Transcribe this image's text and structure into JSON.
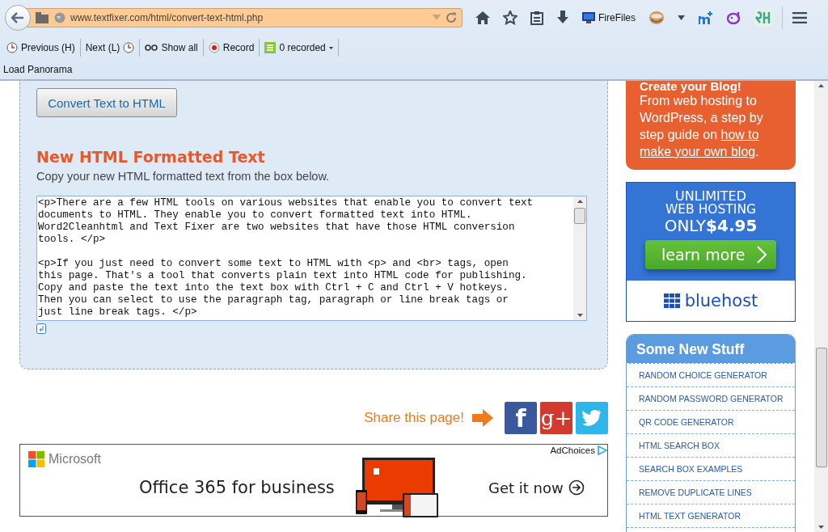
{
  "browser": {
    "url": "www.textfixer.com/html/convert-text-html.php",
    "toolbar_buttons": [
      {
        "kind": "home"
      },
      {
        "kind": "star"
      },
      {
        "kind": "reading-list"
      },
      {
        "kind": "download"
      },
      {
        "kind": "firefiles",
        "label": "FireFiles"
      },
      {
        "kind": "cup"
      },
      {
        "kind": "caret"
      },
      {
        "kind": "extension"
      },
      {
        "kind": "yahoo"
      },
      {
        "kind": "logo"
      }
    ],
    "bookmarks": [
      {
        "kind": "previous",
        "label": "Previous (H)"
      },
      {
        "kind": "next",
        "label": "Next (L)"
      },
      {
        "kind": "showall",
        "label": "Show all"
      },
      {
        "kind": "record",
        "label": "Record"
      },
      {
        "kind": "recorded",
        "label": "0 recorded"
      }
    ],
    "panorama": "Load Panorama"
  },
  "main": {
    "convert_button": "Convert Text to HTML",
    "heading": "New HTML Formatted Text",
    "subtext": "Copy your new HTML formatted text from the box below.",
    "output": "<p>There are a few HTML tools on various websites that enable you to convert text\ndocuments to HTML. They enable you to convert formatted text into HTML.\nWord2Cleanhtml and Text Fixer are two websites that have those HTML conversion\ntools. </p>\n\n<p>If you just need to convert some text to HTML with <p> and <br> tags, open\nthis page. That's a tool that converts plain text into HTML code for publishing.\nCopy and paste the text into the text box with Ctrl + C and Ctrl + V hotkeys.\nThen you can select to use the paragraph tag, paragraph or line break tags or\njust line break tags. </p>",
    "share": {
      "label": "Share this page!",
      "buttons": [
        {
          "kind": "facebook",
          "glyph": "f"
        },
        {
          "kind": "googleplus",
          "glyph": "g+"
        },
        {
          "kind": "twitter"
        }
      ]
    },
    "ad": {
      "brand": "Microsoft",
      "headline": "Office 365 for business",
      "cta": "Get it now",
      "adchoices": "AdChoices"
    }
  },
  "sidebar": {
    "blog_card": {
      "title": "Create your Blog!",
      "text": "From web hosting to WordPress, a step by step guide on ",
      "link": [
        "how to",
        "make your own blog"
      ],
      "end": "."
    },
    "hosting_ad": {
      "line1": "UNLIMITED",
      "line2": "WEB HOSTING",
      "price_label": "ONLY",
      "price": "$4.95",
      "button": "learn more",
      "brand": "bluehost"
    },
    "new_stuff": {
      "title": "Some New Stuff",
      "items": [
        "RANDOM CHOICE GENERATOR",
        "RANDOM PASSWORD GENERATOR",
        "QR CODE GENERATOR",
        "HTML SEARCH BOX",
        "SEARCH BOX EXAMPLES",
        "REMOVE DUPLICATE LINES",
        "HTML TEXT GENERATOR"
      ]
    }
  }
}
